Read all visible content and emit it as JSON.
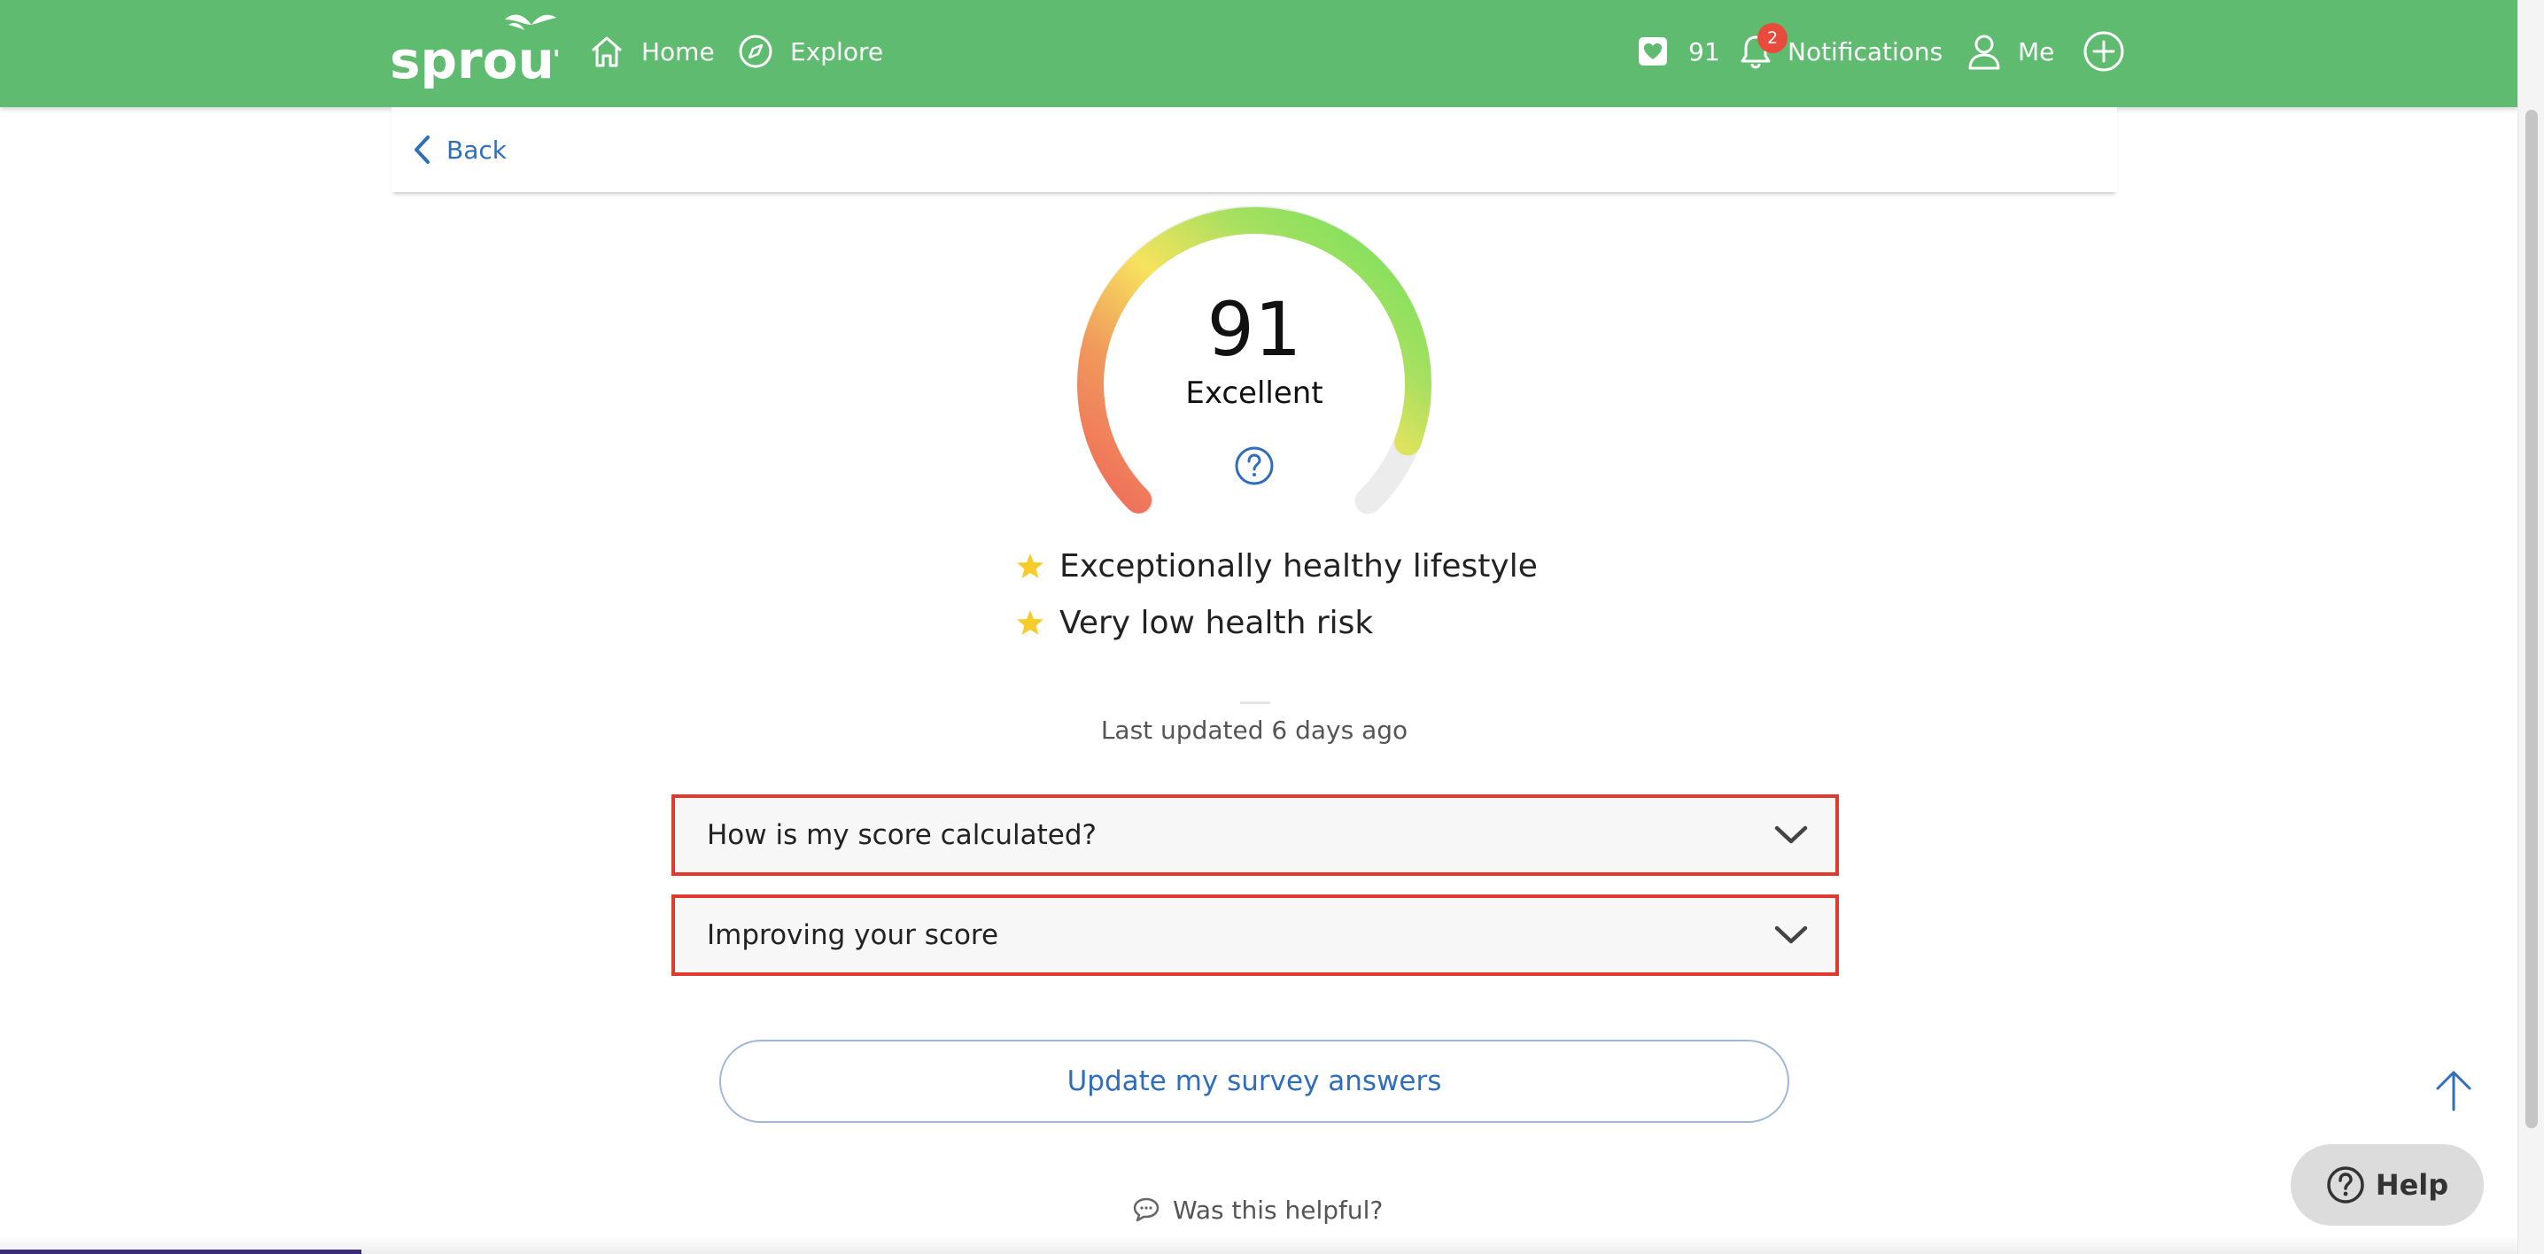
{
  "header": {
    "logo_text": "sprout",
    "nav": {
      "home": "Home",
      "explore": "Explore",
      "score": "91",
      "notifications": "Notifications",
      "notifications_badge": "2",
      "me": "Me"
    },
    "background_color": "#5fbb6f"
  },
  "back": {
    "label": "Back"
  },
  "gauge": {
    "score": "91",
    "rating": "Excellent",
    "level_fraction": 0.91
  },
  "highlights": [
    "Exceptionally healthy lifestyle",
    "Very low health risk"
  ],
  "last_updated": "Last updated 6 days ago",
  "accordion": [
    {
      "title": "How is my score calculated?"
    },
    {
      "title": "Improving your score"
    }
  ],
  "update_button": "Update my survey answers",
  "helpful": "Was this helpful?",
  "help_button": "Help",
  "colors": {
    "accent_blue": "#2f6ebc",
    "highlight_border": "#e03a2f",
    "star": "#f5cc2a"
  }
}
